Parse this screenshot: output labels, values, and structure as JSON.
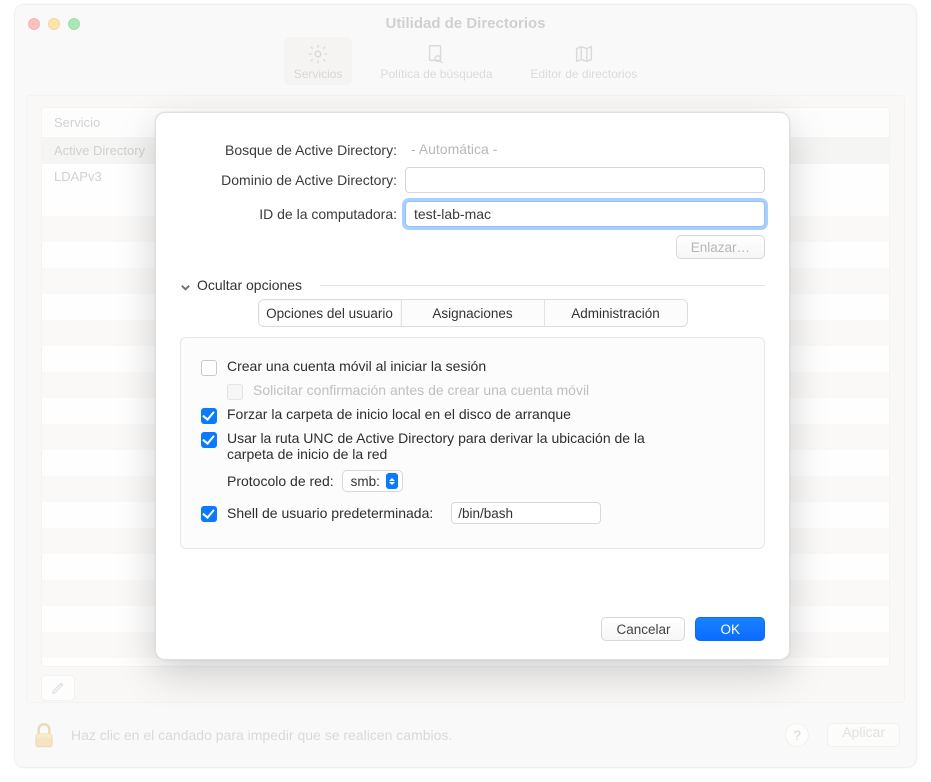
{
  "window": {
    "title": "Utilidad de Directorios",
    "toolbar": [
      {
        "name": "servicios",
        "label": "Servicios",
        "selected": true
      },
      {
        "name": "politica",
        "label": "Política de búsqueda",
        "selected": false
      },
      {
        "name": "editor",
        "label": "Editor de directorios",
        "selected": false
      }
    ],
    "table": {
      "header": "Servicio",
      "rows": [
        {
          "label": "Active Directory",
          "selected": true
        },
        {
          "label": "LDAPv3",
          "selected": false
        }
      ]
    },
    "footer_text": "Haz clic en el candado para impedir que se realicen cambios.",
    "help_label": "?",
    "apply_label": "Aplicar"
  },
  "dialog": {
    "fields": {
      "forest_label": "Bosque de Active Directory:",
      "forest_placeholder": "- Automática -",
      "domain_label": "Dominio de Active Directory:",
      "domain_value": "",
      "computerid_label": "ID de la computadora:",
      "computerid_value": "test-lab-mac"
    },
    "link_button": "Enlazar…",
    "disclosure_label": "Ocultar opciones",
    "tabs": [
      {
        "name": "usuario",
        "label": "Opciones del usuario",
        "active": true
      },
      {
        "name": "asignaciones",
        "label": "Asignaciones",
        "active": false
      },
      {
        "name": "administracion",
        "label": "Administración",
        "active": false
      }
    ],
    "options": {
      "mobile_account": {
        "label": "Crear una cuenta móvil al iniciar la sesión",
        "checked": false
      },
      "confirm_mobile": {
        "label": "Solicitar confirmación antes de crear una cuenta móvil",
        "checked": false,
        "disabled": true
      },
      "force_local_home": {
        "label": "Forzar la carpeta de inicio local en el disco de arranque",
        "checked": true
      },
      "use_unc": {
        "label": "Usar la ruta UNC de Active Directory para derivar la ubicación de la carpeta de inicio de la red",
        "checked": true
      },
      "protocol_label": "Protocolo de red:",
      "protocol_value": "smb:",
      "default_shell": {
        "label": "Shell de usuario predeterminada:",
        "checked": true,
        "value": "/bin/bash"
      }
    },
    "buttons": {
      "cancel": "Cancelar",
      "ok": "OK"
    }
  }
}
